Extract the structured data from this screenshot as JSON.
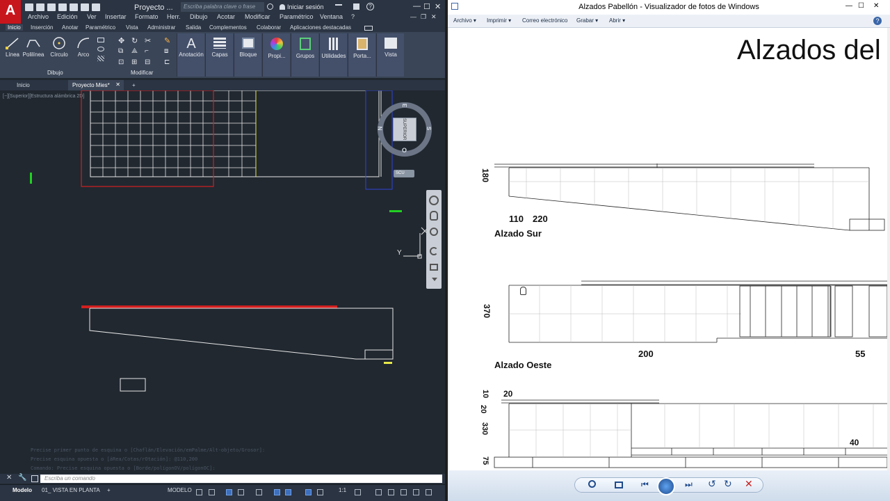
{
  "autocad": {
    "doc_title": "Proyecto ...",
    "search_placeholder": "Escriba palabra clave o frase",
    "login": "Iniciar sesión",
    "menus": [
      "Archivo",
      "Edición",
      "Ver",
      "Insertar",
      "Formato",
      "Herr.",
      "Dibujo",
      "Acotar",
      "Modificar",
      "Paramétrico",
      "Ventana",
      "?"
    ],
    "ribbon_tabs": [
      "Inicio",
      "Inserción",
      "Anotar",
      "Paramétrico",
      "Vista",
      "Administrar",
      "Salida",
      "Complementos",
      "Colaborar",
      "Aplicaciones destacadas"
    ],
    "ribbon_tools": [
      "Línea",
      "Polilínea",
      "Círculo",
      "Arco",
      "Anotación",
      "Capas",
      "Bloque",
      "Propi...",
      "Grupos",
      "Utilidades",
      "Porta...",
      "Vista"
    ],
    "panels": {
      "draw": "Dibujo",
      "modify": "Modificar"
    },
    "doc_tabs": [
      "Inicio",
      "Proyecto Mies*"
    ],
    "viewport_label": "[−][Superior][Estructura alámbrica 2D]",
    "viewcube": {
      "top": "SUPERIOR",
      "north": "N",
      "east": "E",
      "south": "S",
      "west": "O",
      "wcs": "SCU"
    },
    "ucs_y": "Y",
    "cmd_history": [
      "Precise primer punto de esquina o [Chaflán/Elevación/emPalme/Alt-objeto/Grosor]:",
      "Precise esquina opuesta o [áRea/Cotas/rOtación]: @110,200",
      "Comando: Precise esquina opuesta o [Borde/polígonOV/polígonOC]:"
    ],
    "cmd_placeholder": "Escriba un comando",
    "layout_tabs": [
      "Modelo",
      "01_ VISTA EN PLANTA"
    ],
    "status_mode": "MODELO",
    "status_scale": "1:1"
  },
  "viewer": {
    "title": "Alzados Pabellón - Visualizador de fotos de Windows",
    "menus": [
      "Archivo",
      "Imprimir",
      "Correo electrónico",
      "Grabar",
      "Abrir"
    ],
    "drawing": {
      "heading": "Alzados del P",
      "sur_label": "Alzado Sur",
      "oeste_label": "Alzado Oeste",
      "dims": {
        "sur_h": "180",
        "sur_a": "110",
        "sur_b": "220",
        "oeste_h": "370",
        "oeste_a": "200",
        "oeste_b": "55",
        "third_a": "20",
        "third_b": "10",
        "third_c": "20",
        "third_d": "330",
        "third_e": "40",
        "third_f": "75"
      }
    }
  },
  "colors": {
    "acad_bg": "#212830",
    "acad_panel": "#3a4557",
    "grid": "#e8e8e8",
    "red": "#d21f1f",
    "yellow": "#e8e84a",
    "green": "#22d022"
  }
}
